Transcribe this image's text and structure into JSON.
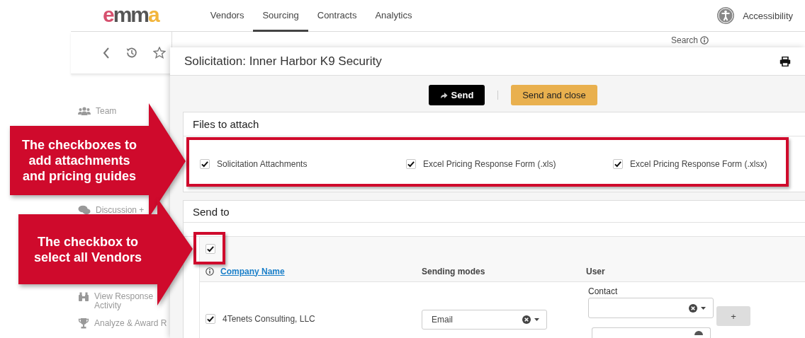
{
  "nav": {
    "logo": [
      {
        "text": "e",
        "color": "#d6506e"
      },
      {
        "text": "mm",
        "color": "#555555"
      },
      {
        "text": "a",
        "color": "#f2b53c"
      }
    ],
    "tabs": [
      {
        "label": "Vendors",
        "selected": false
      },
      {
        "label": "Sourcing",
        "selected": true
      },
      {
        "label": "Contracts",
        "selected": false
      },
      {
        "label": "Analytics",
        "selected": false
      }
    ],
    "accessibility": "Accessibility"
  },
  "background": {
    "search_label": "Search",
    "sidebar_items": [
      {
        "label": "Team",
        "kind": "team"
      },
      {
        "label": "Discussion +",
        "kind": "discussion"
      },
      {
        "label": "View Response Activity",
        "kind": "binoculars"
      },
      {
        "label": "Analyze & Award R",
        "kind": "trophy"
      }
    ]
  },
  "modal": {
    "title": "Solicitation: Inner Harbor K9 Security",
    "buttons": [
      {
        "label": "Send",
        "kind": "primary"
      },
      {
        "label": "Send and close",
        "kind": "warning"
      }
    ],
    "files": {
      "title": "Files to attach",
      "options": [
        {
          "label": "Solicitation Attachments",
          "checked": true
        },
        {
          "label": "Excel Pricing Response Form (.xls)",
          "checked": true
        },
        {
          "label": "Excel Pricing Response Form (.xlsx)",
          "checked": true
        }
      ]
    },
    "send_to": {
      "title": "Send to",
      "select_all": true,
      "columns": [
        "Company Name",
        "Sending modes",
        "User"
      ],
      "rows": [
        {
          "checked": true,
          "company": "4Tenets Consulting, LLC",
          "sending_mode": "Email",
          "contact_label": "Contact",
          "add_label": "+"
        }
      ]
    }
  },
  "annotations": [
    {
      "text": "The checkboxes to add attachments and pricing guides"
    },
    {
      "text": "The checkbox to select all Vendors"
    }
  ]
}
